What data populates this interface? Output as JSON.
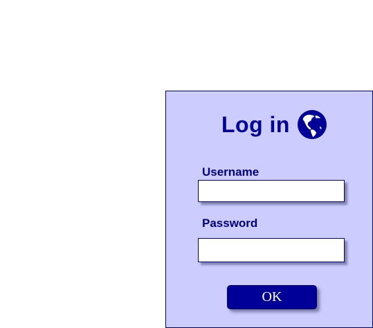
{
  "login": {
    "title": "Log in",
    "title_icon": "globe-icon",
    "username_label": "Username",
    "username_value": "",
    "password_label": "Password",
    "password_value": "",
    "ok_label": "OK"
  },
  "colors": {
    "panel_background": "#ccccff",
    "panel_border": "#000080",
    "accent": "#000099",
    "page_background": "#ffffff"
  }
}
